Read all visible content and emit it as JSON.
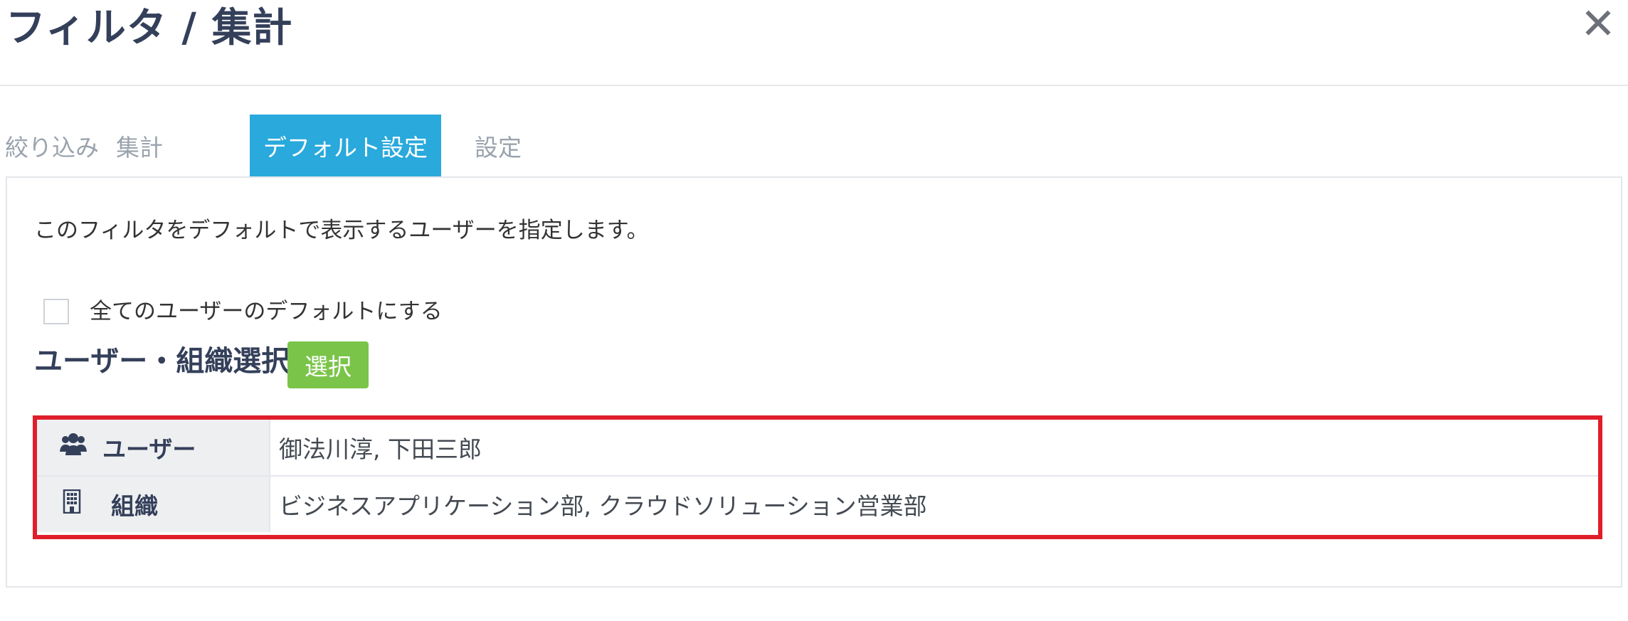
{
  "header": {
    "title": "フィルタ / 集計",
    "close_glyph": "✕",
    "close_icon": "close-icon"
  },
  "tabs": [
    {
      "label": "絞り込み",
      "active": false
    },
    {
      "label": "集計",
      "active": false
    },
    {
      "label": "デフォルト設定",
      "active": true
    },
    {
      "label": "設定",
      "active": false
    }
  ],
  "panel": {
    "description": "このフィルタをデフォルトで表示するユーザーを指定します。",
    "checkbox": {
      "label": "全てのユーザーのデフォルトにする",
      "checked": false
    },
    "section_title": "ユーザー・組織選択",
    "select_button": "選択",
    "rows": [
      {
        "icon": "users-icon",
        "label": "ユーザー",
        "value": "御法川淳, 下田三郎"
      },
      {
        "icon": "building-icon",
        "label": "組織",
        "value": "ビジネスアプリケーション部, クラウドソリューション営業部"
      }
    ]
  },
  "colors": {
    "accent_tab": "#29a9dc",
    "select_button": "#7bc44a",
    "highlight_border": "#e01e2b",
    "title": "#34405a"
  }
}
